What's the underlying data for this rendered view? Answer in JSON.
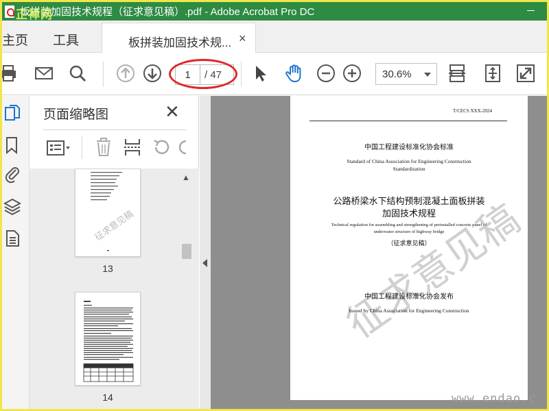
{
  "window": {
    "title": "板拼装加固技术规程（征求意见稿）.pdf - Adobe Acrobat Pro DC",
    "logo_text": "正禅网"
  },
  "tabs": {
    "home_label": "主页",
    "tools_label": "工具",
    "doc_tab_label": "板拼装加固技术规...",
    "close_symbol": "×"
  },
  "toolbar": {
    "current_page": "1",
    "page_total": "/ 47",
    "zoom": "30.6%",
    "annotation_color": "#e0252a"
  },
  "thumbnail_panel": {
    "title": "页面缩略图",
    "close_symbol": "✕",
    "thumbnails": [
      {
        "page_label": "13",
        "watermark": "征求意见稿"
      },
      {
        "page_label": "14"
      }
    ]
  },
  "document": {
    "code": "T/CECS XXX-2024",
    "org_cn": "中国工程建设标准化协会标准",
    "org_en": "Standard of China Association for Engineering Construction Standardization",
    "title_cn_line1": "公路桥梁水下结构预制混凝土面板拼装",
    "title_cn_line2": "加固技术规程",
    "title_en": "Technical regulation for assembling and strengthening of preinstalled concrete panel of underwater structure of highway bridge",
    "draft_note": "（征求意见稿）",
    "issuer_cn": "中国工程建设标准化协会发布",
    "issuer_en": "Issued by China Association for Engineering Construction",
    "watermark": "征求意见稿"
  },
  "site_watermark": "www.endao.c",
  "colors": {
    "titlebar_bg": "#2e8b42",
    "accent_blue": "#1f73d0",
    "frame_border": "#f0e64a"
  },
  "icons": {
    "toolbar": [
      "print-icon",
      "email-icon",
      "search-icon",
      "page-up-icon",
      "page-down-icon",
      "select-cursor-icon",
      "hand-icon",
      "zoom-out-icon",
      "zoom-in-icon",
      "fit-page-icon",
      "full-screen-icon",
      "expand-icon"
    ],
    "rail": [
      "page-thumbnails-icon",
      "bookmark-icon",
      "attachment-icon",
      "layers-icon",
      "page-content-icon"
    ]
  }
}
